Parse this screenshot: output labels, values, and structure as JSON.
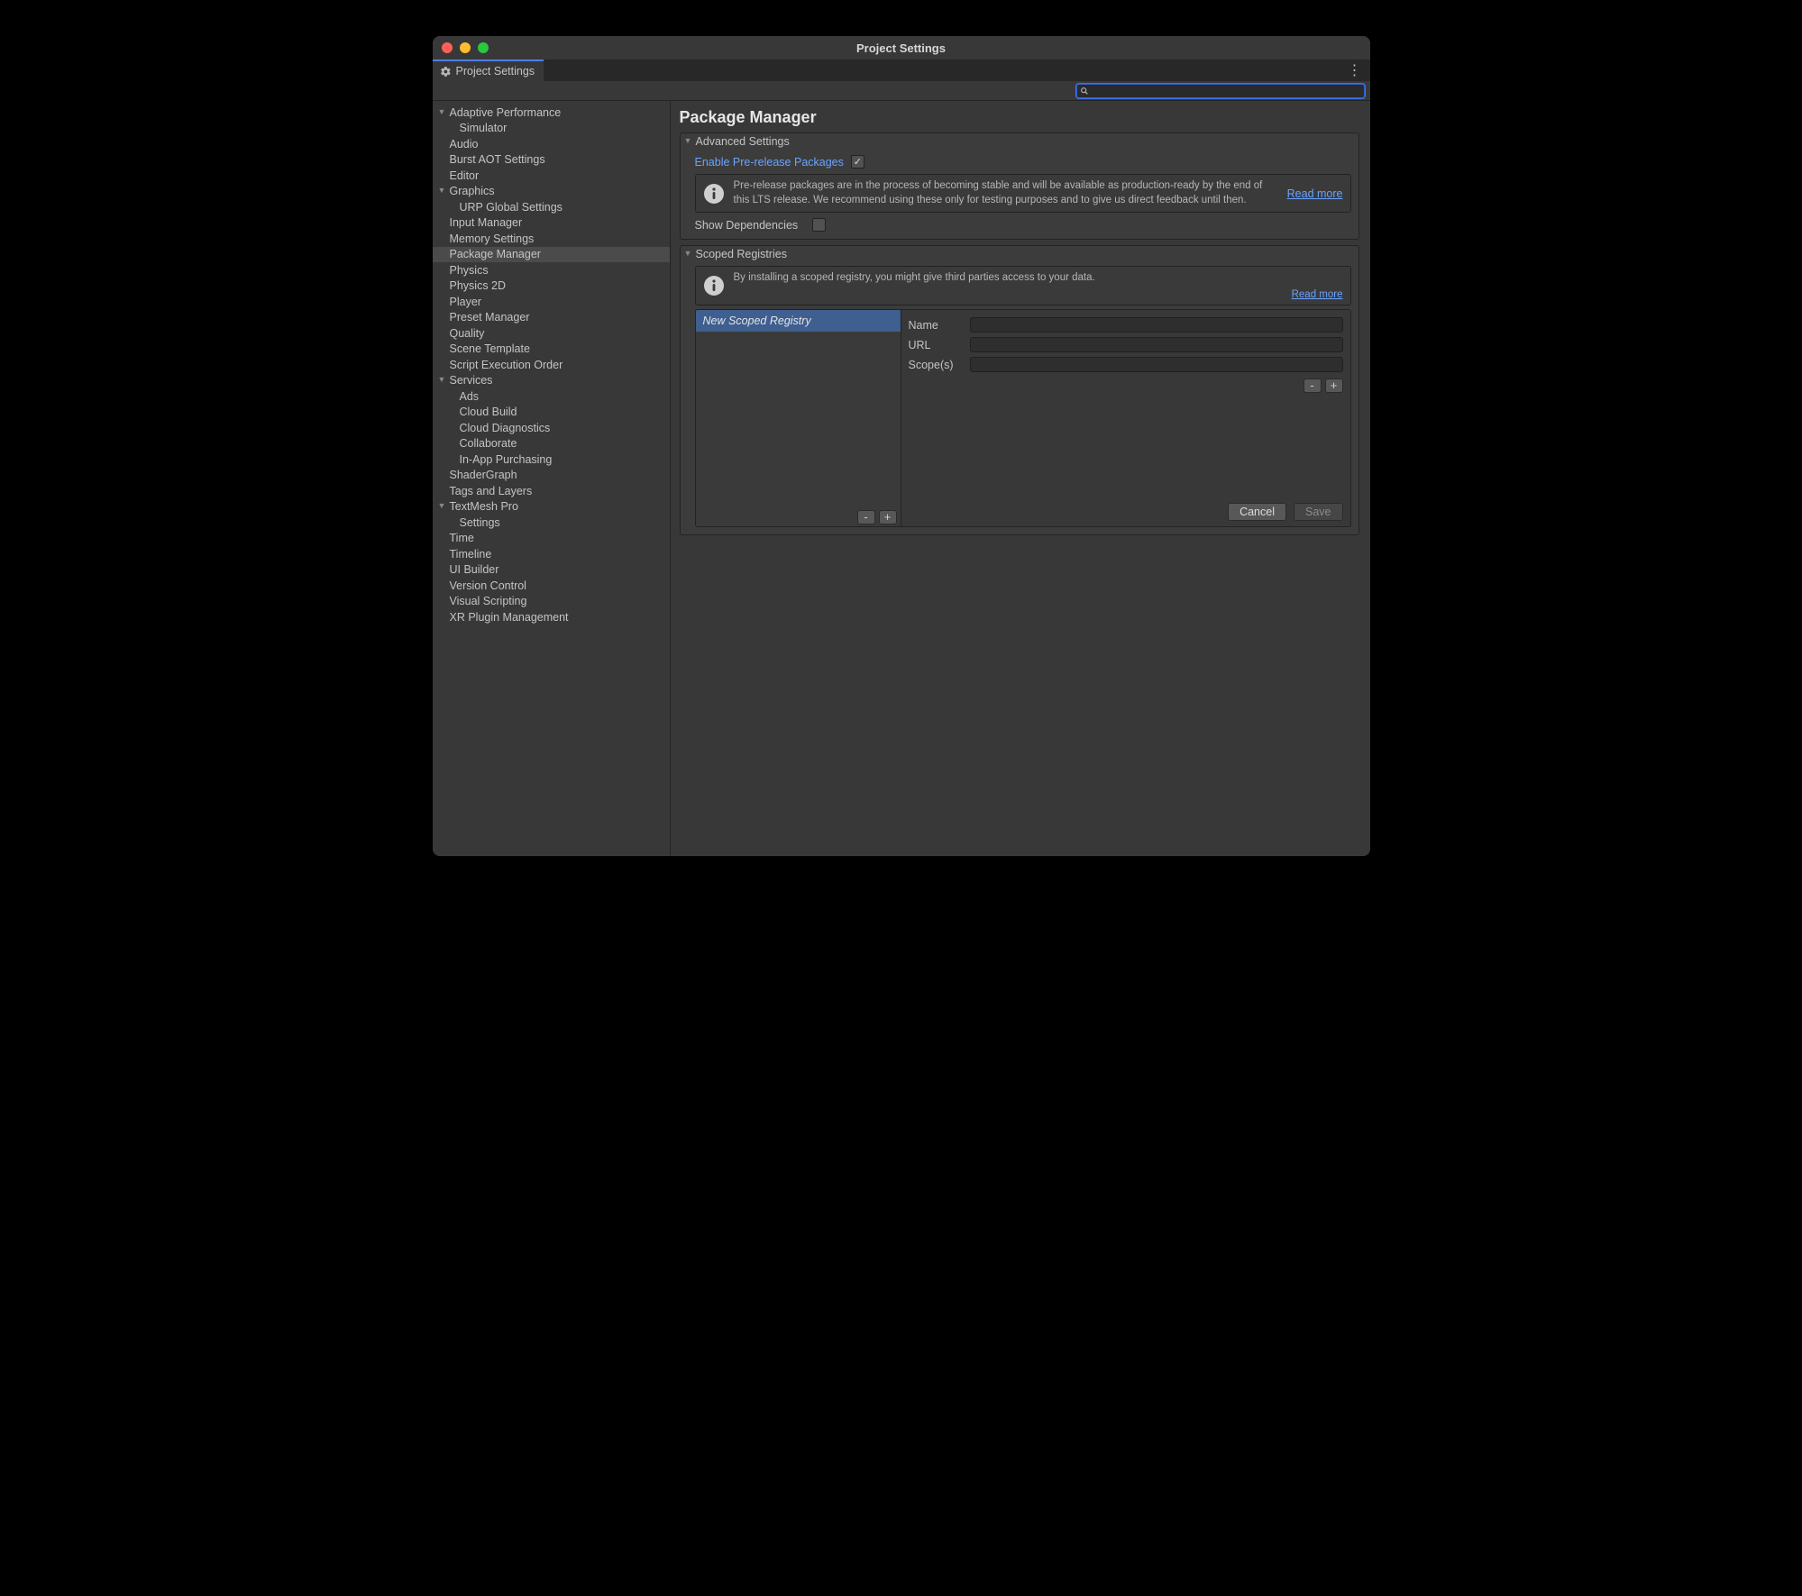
{
  "window_title": "Project Settings",
  "tab_label": "Project Settings",
  "search_value": "",
  "page_heading": "Package Manager",
  "sidebar": [
    {
      "label": "Adaptive Performance",
      "depth": 0,
      "expandable": true,
      "selected": false
    },
    {
      "label": "Simulator",
      "depth": 1,
      "expandable": false,
      "selected": false
    },
    {
      "label": "Audio",
      "depth": 0,
      "expandable": false,
      "selected": false
    },
    {
      "label": "Burst AOT Settings",
      "depth": 0,
      "expandable": false,
      "selected": false
    },
    {
      "label": "Editor",
      "depth": 0,
      "expandable": false,
      "selected": false
    },
    {
      "label": "Graphics",
      "depth": 0,
      "expandable": true,
      "selected": false
    },
    {
      "label": "URP Global Settings",
      "depth": 1,
      "expandable": false,
      "selected": false
    },
    {
      "label": "Input Manager",
      "depth": 0,
      "expandable": false,
      "selected": false
    },
    {
      "label": "Memory Settings",
      "depth": 0,
      "expandable": false,
      "selected": false
    },
    {
      "label": "Package Manager",
      "depth": 0,
      "expandable": false,
      "selected": true
    },
    {
      "label": "Physics",
      "depth": 0,
      "expandable": false,
      "selected": false
    },
    {
      "label": "Physics 2D",
      "depth": 0,
      "expandable": false,
      "selected": false
    },
    {
      "label": "Player",
      "depth": 0,
      "expandable": false,
      "selected": false
    },
    {
      "label": "Preset Manager",
      "depth": 0,
      "expandable": false,
      "selected": false
    },
    {
      "label": "Quality",
      "depth": 0,
      "expandable": false,
      "selected": false
    },
    {
      "label": "Scene Template",
      "depth": 0,
      "expandable": false,
      "selected": false
    },
    {
      "label": "Script Execution Order",
      "depth": 0,
      "expandable": false,
      "selected": false
    },
    {
      "label": "Services",
      "depth": 0,
      "expandable": true,
      "selected": false
    },
    {
      "label": "Ads",
      "depth": 1,
      "expandable": false,
      "selected": false
    },
    {
      "label": "Cloud Build",
      "depth": 1,
      "expandable": false,
      "selected": false
    },
    {
      "label": "Cloud Diagnostics",
      "depth": 1,
      "expandable": false,
      "selected": false
    },
    {
      "label": "Collaborate",
      "depth": 1,
      "expandable": false,
      "selected": false
    },
    {
      "label": "In-App Purchasing",
      "depth": 1,
      "expandable": false,
      "selected": false
    },
    {
      "label": "ShaderGraph",
      "depth": 0,
      "expandable": false,
      "selected": false
    },
    {
      "label": "Tags and Layers",
      "depth": 0,
      "expandable": false,
      "selected": false
    },
    {
      "label": "TextMesh Pro",
      "depth": 0,
      "expandable": true,
      "selected": false
    },
    {
      "label": "Settings",
      "depth": 1,
      "expandable": false,
      "selected": false
    },
    {
      "label": "Time",
      "depth": 0,
      "expandable": false,
      "selected": false
    },
    {
      "label": "Timeline",
      "depth": 0,
      "expandable": false,
      "selected": false
    },
    {
      "label": "UI Builder",
      "depth": 0,
      "expandable": false,
      "selected": false
    },
    {
      "label": "Version Control",
      "depth": 0,
      "expandable": false,
      "selected": false
    },
    {
      "label": "Visual Scripting",
      "depth": 0,
      "expandable": false,
      "selected": false
    },
    {
      "label": "XR Plugin Management",
      "depth": 0,
      "expandable": false,
      "selected": false
    }
  ],
  "advanced": {
    "section_title": "Advanced Settings",
    "prerelease_label": "Enable Pre-release Packages",
    "prerelease_checked": true,
    "prerelease_info": "Pre-release packages are in the process of becoming stable and will be available as production-ready by the end of this LTS release. We recommend using these only for testing purposes and to give us direct feedback until then.",
    "read_more": "Read more",
    "show_deps_label": "Show Dependencies",
    "show_deps_checked": false
  },
  "scoped": {
    "section_title": "Scoped Registries",
    "info": "By installing a scoped registry, you might give third parties access to your data.",
    "read_more": "Read more",
    "list_selected": "New Scoped Registry",
    "form": {
      "name_label": "Name",
      "name_value": "",
      "url_label": "URL",
      "url_value": "",
      "scopes_label": "Scope(s)",
      "scopes_value": ""
    },
    "buttons": {
      "minus": "-",
      "plus": "+",
      "cancel": "Cancel",
      "save": "Save"
    }
  }
}
